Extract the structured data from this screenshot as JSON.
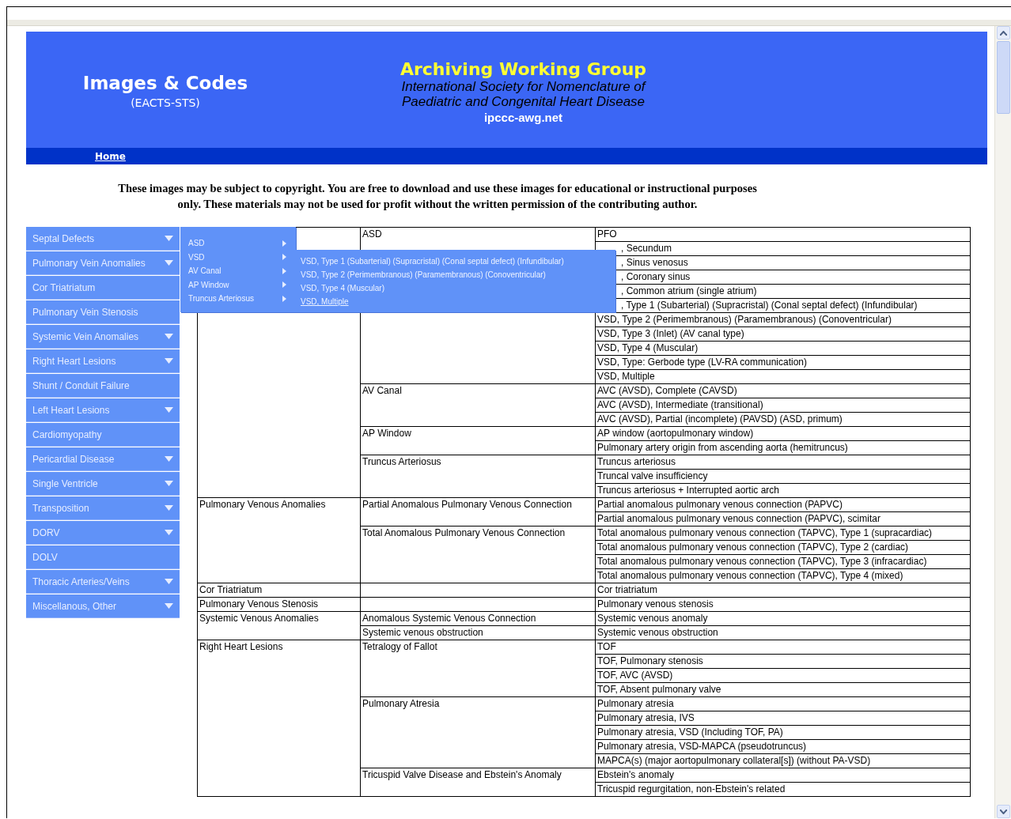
{
  "header": {
    "site_title": "Images & Codes",
    "site_subtitle": "(EACTS-STS)",
    "group_title": "Archiving Working Group",
    "org_line_1": "International Society for Nomenclature of",
    "org_line_2": "Paediatric and Congenital Heart Disease",
    "website": "ipccc-awg.net"
  },
  "nav": [
    {
      "label": "Home"
    }
  ],
  "notice": "These images may be subject to copyright. You are free to download and use these images for educational or instructional purposes only. These materials may not be used for profit without the written permission of the contributing author.",
  "sidebar": {
    "items": [
      {
        "label": "Septal Defects",
        "has_submenu": true
      },
      {
        "label": "Pulmonary Vein Anomalies",
        "has_submenu": true
      },
      {
        "label": "Cor Triatriatum",
        "has_submenu": false
      },
      {
        "label": "Pulmonary Vein Stenosis",
        "has_submenu": false
      },
      {
        "label": "Systemic Vein Anomalies",
        "has_submenu": true
      },
      {
        "label": "Right Heart Lesions",
        "has_submenu": true
      },
      {
        "label": "Shunt / Conduit Failure",
        "has_submenu": false
      },
      {
        "label": "Left Heart Lesions",
        "has_submenu": true
      },
      {
        "label": "Cardiomyopathy",
        "has_submenu": false
      },
      {
        "label": "Pericardial Disease",
        "has_submenu": true
      },
      {
        "label": "Single Ventricle",
        "has_submenu": true
      },
      {
        "label": "Transposition",
        "has_submenu": true
      },
      {
        "label": "DORV",
        "has_submenu": true
      },
      {
        "label": "DOLV",
        "has_submenu": false
      },
      {
        "label": "Thoracic Arteries/Veins",
        "has_submenu": true
      },
      {
        "label": "Miscellanous, Other",
        "has_submenu": true
      }
    ]
  },
  "submenu": {
    "items": [
      {
        "label": "ASD",
        "has_submenu": true
      },
      {
        "label": "VSD",
        "has_submenu": true
      },
      {
        "label": "AV Canal",
        "has_submenu": true
      },
      {
        "label": "AP Window",
        "has_submenu": true
      },
      {
        "label": "Truncus Arteriosus",
        "has_submenu": true
      }
    ]
  },
  "flyout": {
    "items": [
      {
        "label": "VSD, Type 1 (Subarterial) (Supracristal) (Conal septal defect) (Infundibular)",
        "selected": false
      },
      {
        "label": "VSD, Type 2 (Perimembranous) (Paramembranous) (Conoventricular)",
        "selected": false
      },
      {
        "label": "VSD, Type 4 (Muscular)",
        "selected": false
      },
      {
        "label": "VSD, Multiple",
        "selected": true
      }
    ]
  },
  "table": {
    "groups": [
      {
        "subgroups": [
          {
            "name": "ASD",
            "codes": [
              {
                "text": "PFO",
                "under_menu": false
              },
              {
                "text": ", Secundum",
                "under_menu": true
              },
              {
                "text": ", Sinus venosus",
                "under_menu": true
              },
              {
                "text": ", Coronary sinus",
                "under_menu": true
              },
              {
                "text": ", Common atrium (single atrium)",
                "under_menu": true
              }
            ]
          },
          {
            "codes": [
              {
                "text": ", Type 1 (Subarterial) (Supracristal) (Conal septal defect) (Infundibular)",
                "under_menu": true
              },
              {
                "text": "VSD, Type 2 (Perimembranous) (Paramembranous) (Conoventricular)",
                "under_menu": false
              },
              {
                "text": "VSD, Type 3 (Inlet) (AV canal type)",
                "under_menu": false
              },
              {
                "text": "VSD, Type 4 (Muscular)",
                "under_menu": false
              },
              {
                "text": "VSD, Type: Gerbode type (LV-RA communication)",
                "under_menu": false
              },
              {
                "text": "VSD, Multiple",
                "under_menu": false
              }
            ]
          },
          {
            "name": "AV Canal",
            "codes": [
              {
                "text": "AVC (AVSD), Complete (CAVSD)",
                "under_menu": false
              },
              {
                "text": "AVC (AVSD), Intermediate (transitional)",
                "under_menu": false
              },
              {
                "text": "AVC (AVSD), Partial (incomplete) (PAVSD) (ASD, primum)",
                "under_menu": false
              }
            ]
          },
          {
            "name": "AP Window",
            "codes": [
              {
                "text": "AP window (aortopulmonary window)",
                "under_menu": false
              },
              {
                "text": "Pulmonary artery origin from ascending aorta (hemitruncus)",
                "under_menu": false
              }
            ]
          },
          {
            "name": "Truncus Arteriosus",
            "codes": [
              {
                "text": "Truncus arteriosus",
                "under_menu": false
              },
              {
                "text": "Truncal valve insufficiency",
                "under_menu": false
              },
              {
                "text": "Truncus arteriosus + Interrupted aortic arch",
                "under_menu": false
              }
            ]
          }
        ]
      },
      {
        "category": "Pulmonary Venous Anomalies",
        "subgroups": [
          {
            "name": "Partial Anomalous Pulmonary Venous Connection",
            "codes": [
              {
                "text": "Partial anomalous pulmonary venous connection (PAPVC)",
                "under_menu": false
              },
              {
                "text": "Partial anomalous pulmonary venous connection (PAPVC), scimitar",
                "under_menu": false
              }
            ]
          },
          {
            "name": "Total Anomalous Pulmonary Venous Connection",
            "codes": [
              {
                "text": "Total anomalous pulmonary venous connection (TAPVC), Type 1 (supracardiac)",
                "under_menu": false
              },
              {
                "text": "Total anomalous pulmonary venous connection (TAPVC), Type 2 (cardiac)",
                "under_menu": false
              },
              {
                "text": "Total anomalous pulmonary venous connection (TAPVC), Type 3 (infracardiac)",
                "under_menu": false
              },
              {
                "text": "Total anomalous pulmonary venous connection (TAPVC), Type 4 (mixed)",
                "under_menu": false
              }
            ]
          }
        ]
      },
      {
        "category": "Cor Triatriatum",
        "subgroups": [
          {
            "codes": [
              {
                "text": "Cor triatriatum",
                "under_menu": false
              }
            ]
          }
        ]
      },
      {
        "category": "Pulmonary Venous Stenosis",
        "subgroups": [
          {
            "codes": [
              {
                "text": "Pulmonary venous stenosis",
                "under_menu": false
              }
            ]
          }
        ]
      },
      {
        "category": "Systemic Venous Anomalies",
        "subgroups": [
          {
            "name": "Anomalous Systemic Venous Connection",
            "codes": [
              {
                "text": "Systemic venous anomaly",
                "under_menu": false
              }
            ]
          },
          {
            "name": "Systemic venous obstruction",
            "codes": [
              {
                "text": "Systemic venous obstruction",
                "under_menu": false
              }
            ]
          }
        ]
      },
      {
        "category": "Right Heart Lesions",
        "subgroups": [
          {
            "name": "Tetralogy of Fallot",
            "codes": [
              {
                "text": "TOF",
                "under_menu": false
              },
              {
                "text": "TOF, Pulmonary stenosis",
                "under_menu": false
              },
              {
                "text": "TOF, AVC (AVSD)",
                "under_menu": false
              },
              {
                "text": "TOF, Absent pulmonary valve",
                "under_menu": false
              }
            ]
          },
          {
            "name": "Pulmonary Atresia",
            "codes": [
              {
                "text": "Pulmonary atresia",
                "under_menu": false
              },
              {
                "text": "Pulmonary atresia, IVS",
                "under_menu": false
              },
              {
                "text": "Pulmonary atresia, VSD (Including TOF, PA)",
                "under_menu": false
              },
              {
                "text": "Pulmonary atresia, VSD-MAPCA (pseudotruncus)",
                "under_menu": false
              },
              {
                "text": "MAPCA(s) (major aortopulmonary collateral[s]) (without PA-VSD)",
                "under_menu": false
              }
            ]
          },
          {
            "name": "Tricuspid Valve Disease and Ebstein's Anomaly",
            "codes": [
              {
                "text": "Ebstein's anomaly",
                "under_menu": false
              },
              {
                "text": "Tricuspid regurgitation, non-Ebstein's related",
                "under_menu": false
              }
            ]
          }
        ]
      }
    ]
  }
}
